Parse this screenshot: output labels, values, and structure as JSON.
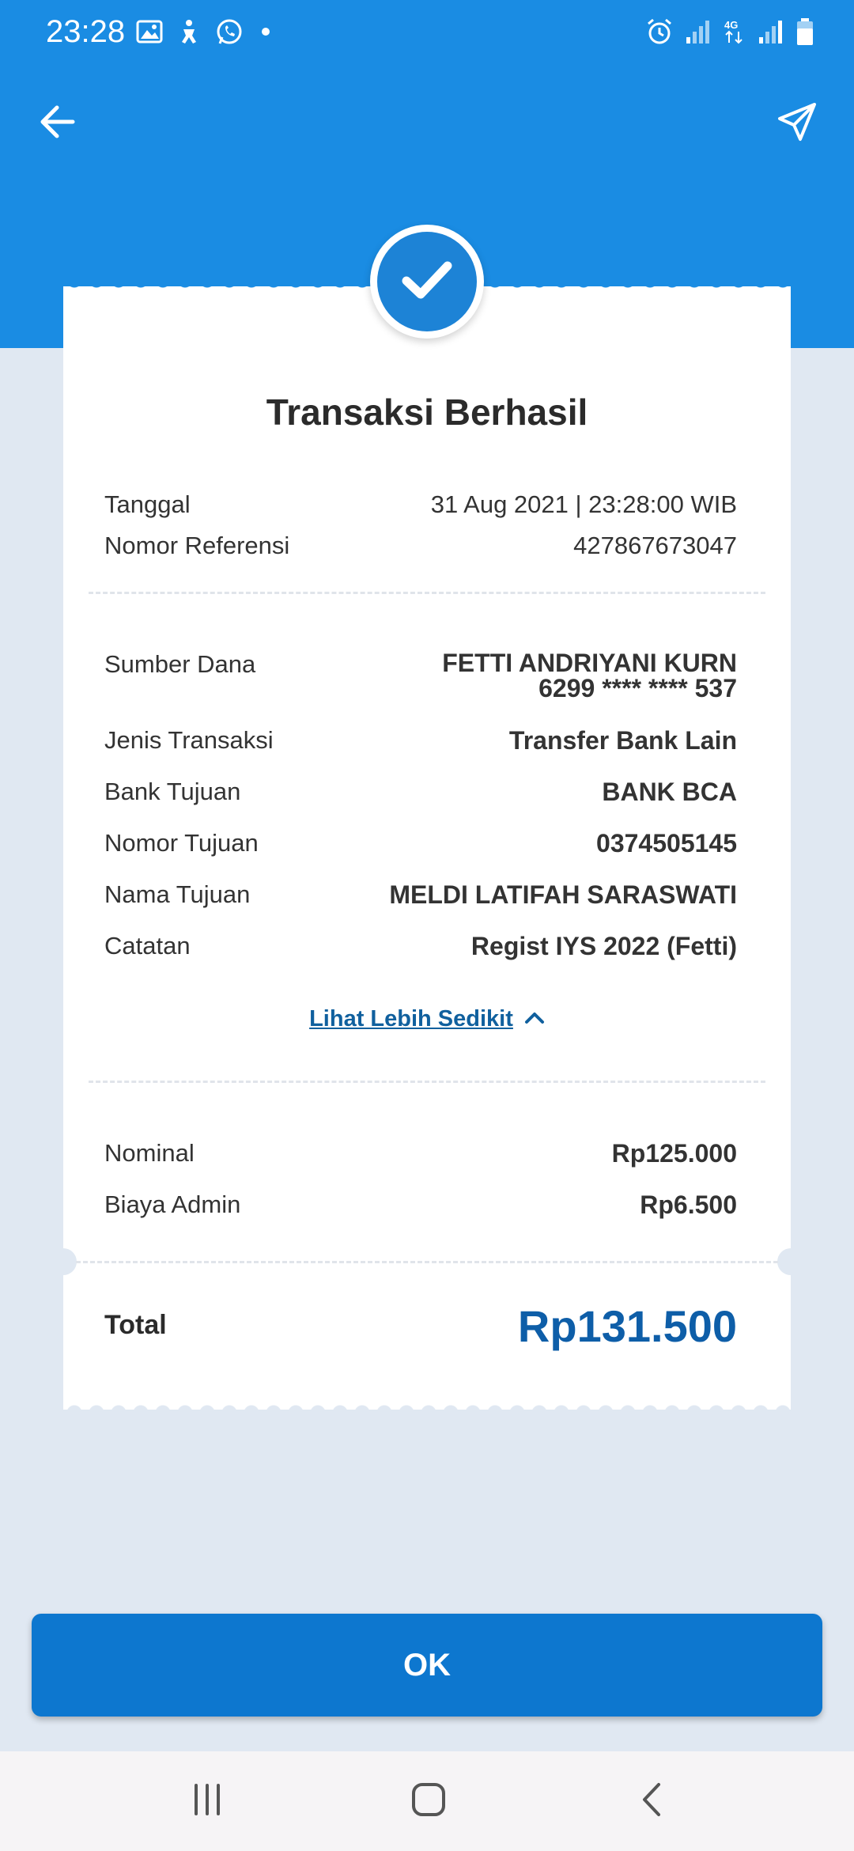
{
  "status_bar": {
    "time": "23:28",
    "network": "4G",
    "icons": [
      "gallery-icon",
      "accessibility-icon",
      "whatsapp-icon",
      "dot-icon",
      "alarm-icon",
      "signal-icon",
      "signal-4g-icon",
      "battery-icon"
    ]
  },
  "header": {
    "back_icon": "arrow-left-icon",
    "share_icon": "send-icon"
  },
  "receipt": {
    "title": "Transaksi Berhasil",
    "date_label": "Tanggal",
    "date_value": "31 Aug 2021 | 23:28:00 WIB",
    "ref_label": "Nomor Referensi",
    "ref_value": "427867673047",
    "source_label": "Sumber Dana",
    "source_name": "FETTI ANDRIYANI KURN",
    "source_account": "6299 **** **** 537",
    "type_label": "Jenis Transaksi",
    "type_value": "Transfer Bank Lain",
    "bank_label": "Bank Tujuan",
    "bank_value": "BANK BCA",
    "dest_no_label": "Nomor Tujuan",
    "dest_no_value": "0374505145",
    "dest_name_label": "Nama Tujuan",
    "dest_name_value": "MELDI LATIFAH SARASWATI",
    "note_label": "Catatan",
    "note_value": "Regist IYS 2022 (Fetti)",
    "toggle_link": "Lihat Lebih Sedikit",
    "nominal_label": "Nominal",
    "nominal_value": "Rp125.000",
    "fee_label": "Biaya Admin",
    "fee_value": "Rp6.500",
    "total_label": "Total",
    "total_value": "Rp131.500"
  },
  "ok_button": "OK",
  "colors": {
    "primary": "#1a8ce3",
    "button": "#0d77cf",
    "accent_text": "#0e5ea8",
    "background": "#e0e8f2"
  }
}
